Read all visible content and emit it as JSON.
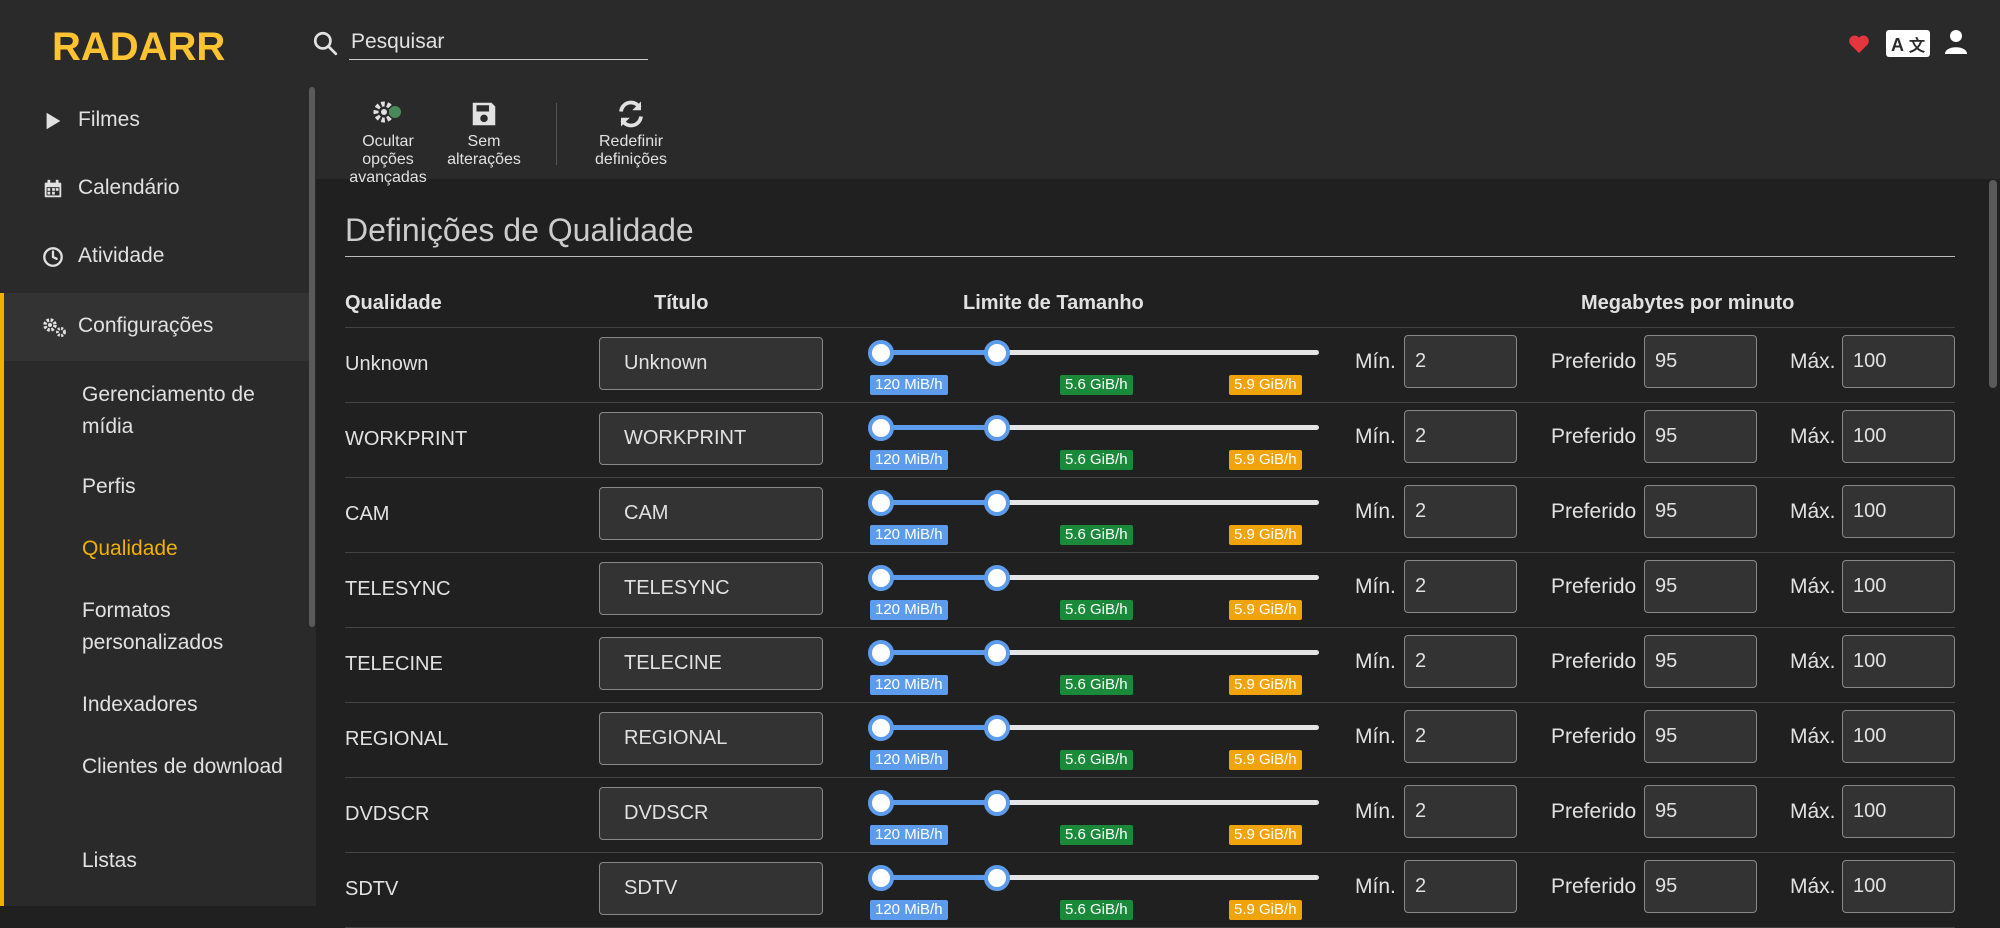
{
  "header": {
    "logo_text": "RADARR",
    "search_placeholder": "Pesquisar"
  },
  "sidebar": {
    "items": [
      {
        "label": "Filmes",
        "icon": "play-icon"
      },
      {
        "label": "Calendário",
        "icon": "calendar-icon"
      },
      {
        "label": "Atividade",
        "icon": "clock-icon"
      },
      {
        "label": "Configurações",
        "icon": "cogs-icon"
      }
    ],
    "sub_items": [
      {
        "label": "Gerenciamento de mídia"
      },
      {
        "label": "Perfis"
      },
      {
        "label": "Qualidade"
      },
      {
        "label": "Formatos personalizados"
      },
      {
        "label": "Indexadores"
      },
      {
        "label": "Clientes de download"
      },
      {
        "label": "Listas"
      }
    ]
  },
  "toolbar": {
    "advanced_label": "Ocultar opções avançadas",
    "save_label": "Sem alterações",
    "reset_label": "Redefinir definições"
  },
  "page": {
    "title": "Definições de Qualidade",
    "columns": {
      "quality": "Qualidade",
      "title": "Título",
      "size_limit": "Limite de Tamanho",
      "mpm": "Megabytes por minuto"
    },
    "labels": {
      "min": "Mín.",
      "preferred": "Preferido",
      "max": "Máx."
    }
  },
  "rows": [
    {
      "quality": "Unknown",
      "title": "Unknown",
      "min_tag": "120 MiB/h",
      "pref_tag": "5.6 GiB/h",
      "max_tag": "5.9 GiB/h",
      "min": "2",
      "preferred": "95",
      "max": "100"
    },
    {
      "quality": "WORKPRINT",
      "title": "WORKPRINT",
      "min_tag": "120 MiB/h",
      "pref_tag": "5.6 GiB/h",
      "max_tag": "5.9 GiB/h",
      "min": "2",
      "preferred": "95",
      "max": "100"
    },
    {
      "quality": "CAM",
      "title": "CAM",
      "min_tag": "120 MiB/h",
      "pref_tag": "5.6 GiB/h",
      "max_tag": "5.9 GiB/h",
      "min": "2",
      "preferred": "95",
      "max": "100"
    },
    {
      "quality": "TELESYNC",
      "title": "TELESYNC",
      "min_tag": "120 MiB/h",
      "pref_tag": "5.6 GiB/h",
      "max_tag": "5.9 GiB/h",
      "min": "2",
      "preferred": "95",
      "max": "100"
    },
    {
      "quality": "TELECINE",
      "title": "TELECINE",
      "min_tag": "120 MiB/h",
      "pref_tag": "5.6 GiB/h",
      "max_tag": "5.9 GiB/h",
      "min": "2",
      "preferred": "95",
      "max": "100"
    },
    {
      "quality": "REGIONAL",
      "title": "REGIONAL",
      "min_tag": "120 MiB/h",
      "pref_tag": "5.6 GiB/h",
      "max_tag": "5.9 GiB/h",
      "min": "2",
      "preferred": "95",
      "max": "100"
    },
    {
      "quality": "DVDSCR",
      "title": "DVDSCR",
      "min_tag": "120 MiB/h",
      "pref_tag": "5.6 GiB/h",
      "max_tag": "5.9 GiB/h",
      "min": "2",
      "preferred": "95",
      "max": "100"
    },
    {
      "quality": "SDTV",
      "title": "SDTV",
      "min_tag": "120 MiB/h",
      "pref_tag": "5.6 GiB/h",
      "max_tag": "5.9 GiB/h",
      "min": "2",
      "preferred": "95",
      "max": "100"
    }
  ],
  "colors": {
    "accent": "#f0b000",
    "slider_blue": "#5d9cec",
    "tag_green": "#1a8a3a",
    "tag_orange": "#f0a30a",
    "heart": "#e5353f"
  }
}
